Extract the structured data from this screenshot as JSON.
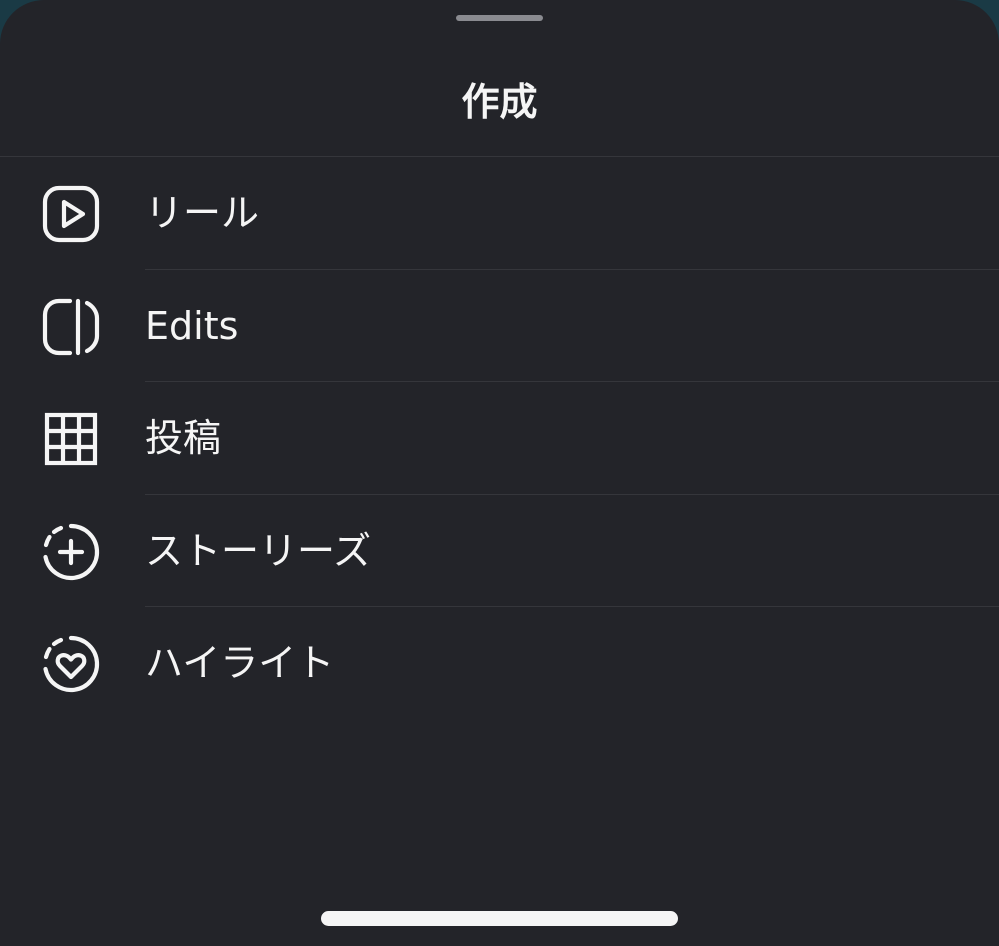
{
  "sheet": {
    "title": "作成"
  },
  "menu": {
    "items": [
      {
        "label": "リール",
        "icon": "reels-icon"
      },
      {
        "label": "Edits",
        "icon": "edits-icon"
      },
      {
        "label": "投稿",
        "icon": "post-grid-icon"
      },
      {
        "label": "ストーリーズ",
        "icon": "story-add-icon"
      },
      {
        "label": "ハイライト",
        "icon": "highlight-heart-icon"
      }
    ]
  },
  "colors": {
    "sheet_background": "#232429",
    "text": "#f5f5f5",
    "divider": "#35363b",
    "grabber": "#8a8b90"
  }
}
